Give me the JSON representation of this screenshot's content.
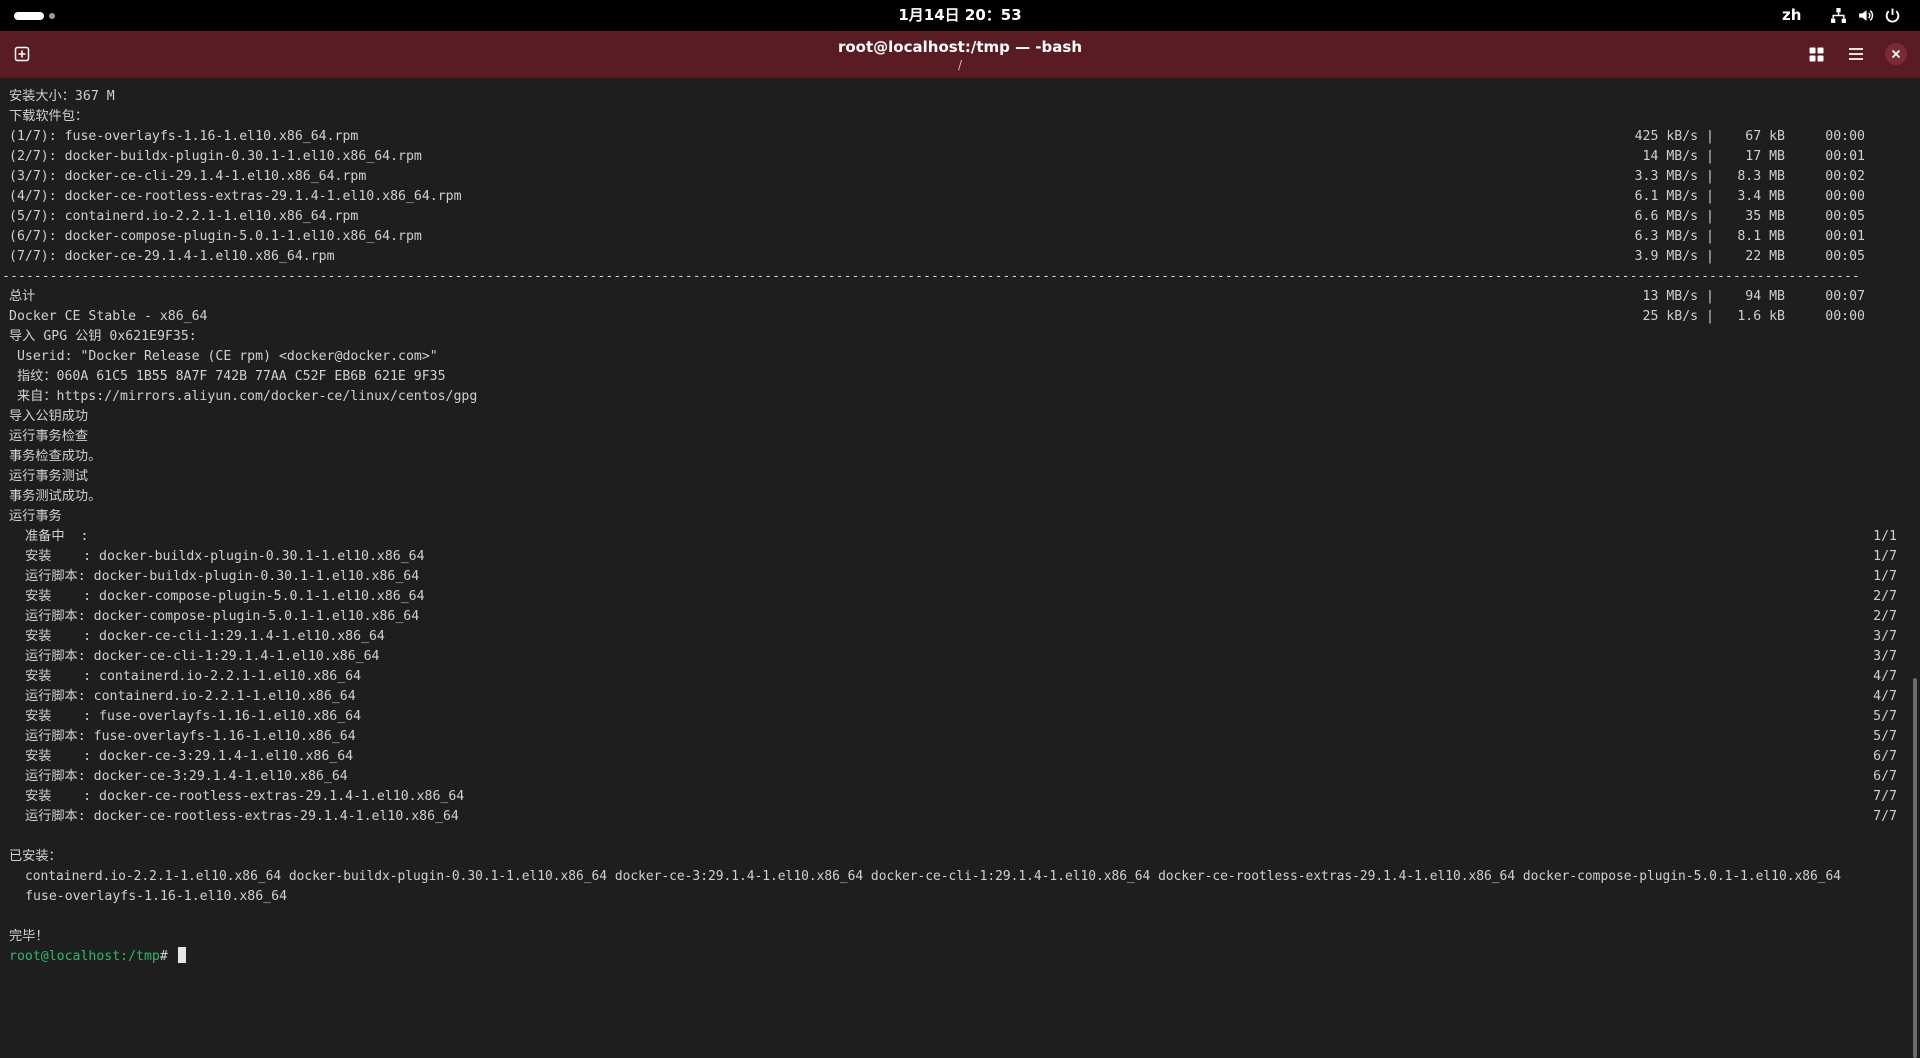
{
  "topbar": {
    "clock": "1月14日  20：53",
    "lang": "zh",
    "tray_icons": [
      "network-icon",
      "volume-icon",
      "power-icon"
    ]
  },
  "window": {
    "title": "root@localhost:/tmp — -bash",
    "subtitle": "/",
    "accent_color": "#5a1c24"
  },
  "terminal": {
    "install_size": "安装大小：367 M",
    "downloading": "下载软件包：",
    "downloads": [
      {
        "name": "(1/7): fuse-overlayfs-1.16-1.el10.x86_64.rpm",
        "rate": "425 kB/s |",
        "size": "67 kB",
        "time": "00:00"
      },
      {
        "name": "(2/7): docker-buildx-plugin-0.30.1-1.el10.x86_64.rpm",
        "rate": "14 MB/s |",
        "size": "17 MB",
        "time": "00:01"
      },
      {
        "name": "(3/7): docker-ce-cli-29.1.4-1.el10.x86_64.rpm",
        "rate": "3.3 MB/s |",
        "size": "8.3 MB",
        "time": "00:02"
      },
      {
        "name": "(4/7): docker-ce-rootless-extras-29.1.4-1.el10.x86_64.rpm",
        "rate": "6.1 MB/s |",
        "size": "3.4 MB",
        "time": "00:00"
      },
      {
        "name": "(5/7): containerd.io-2.2.1-1.el10.x86_64.rpm",
        "rate": "6.6 MB/s |",
        "size": "35 MB",
        "time": "00:05"
      },
      {
        "name": "(6/7): docker-compose-plugin-5.0.1-1.el10.x86_64.rpm",
        "rate": "6.3 MB/s |",
        "size": "8.1 MB",
        "time": "00:01"
      },
      {
        "name": "(7/7): docker-ce-29.1.4-1.el10.x86_64.rpm",
        "rate": "3.9 MB/s |",
        "size": "22 MB",
        "time": "00:05"
      }
    ],
    "separator": "------------------------------------------------------------------------------------------------------------------------------------------------------------------------------------------------------------------------------------------",
    "total": {
      "name": "总计",
      "rate": "13 MB/s |",
      "size": "94 MB",
      "time": "00:07"
    },
    "repo": {
      "name": "Docker CE Stable - x86_64",
      "rate": "25 kB/s |",
      "size": "1.6 kB",
      "time": "00:00"
    },
    "gpg_lines": [
      "导入 GPG 公钥 0x621E9F35:",
      " Userid: \"Docker Release (CE rpm) <docker@docker.com>\"",
      " 指纹：060A 61C5 1B55 8A7F 742B 77AA C52F EB6B 621E 9F35",
      " 来自：https://mirrors.aliyun.com/docker-ce/linux/centos/gpg",
      "导入公钥成功",
      "运行事务检查",
      "事务检查成功。",
      "运行事务测试",
      "事务测试成功。",
      "运行事务"
    ],
    "transaction": [
      {
        "step": "准备中  :",
        "progress": "1/1"
      },
      {
        "step": "安装    : docker-buildx-plugin-0.30.1-1.el10.x86_64",
        "progress": "1/7"
      },
      {
        "step": "运行脚本: docker-buildx-plugin-0.30.1-1.el10.x86_64",
        "progress": "1/7"
      },
      {
        "step": "安装    : docker-compose-plugin-5.0.1-1.el10.x86_64",
        "progress": "2/7"
      },
      {
        "step": "运行脚本: docker-compose-plugin-5.0.1-1.el10.x86_64",
        "progress": "2/7"
      },
      {
        "step": "安装    : docker-ce-cli-1:29.1.4-1.el10.x86_64",
        "progress": "3/7"
      },
      {
        "step": "运行脚本: docker-ce-cli-1:29.1.4-1.el10.x86_64",
        "progress": "3/7"
      },
      {
        "step": "安装    : containerd.io-2.2.1-1.el10.x86_64",
        "progress": "4/7"
      },
      {
        "step": "运行脚本: containerd.io-2.2.1-1.el10.x86_64",
        "progress": "4/7"
      },
      {
        "step": "安装    : fuse-overlayfs-1.16-1.el10.x86_64",
        "progress": "5/7"
      },
      {
        "step": "运行脚本: fuse-overlayfs-1.16-1.el10.x86_64",
        "progress": "5/7"
      },
      {
        "step": "安装    : docker-ce-3:29.1.4-1.el10.x86_64",
        "progress": "6/7"
      },
      {
        "step": "运行脚本: docker-ce-3:29.1.4-1.el10.x86_64",
        "progress": "6/7"
      },
      {
        "step": "安装    : docker-ce-rootless-extras-29.1.4-1.el10.x86_64",
        "progress": "7/7"
      },
      {
        "step": "运行脚本: docker-ce-rootless-extras-29.1.4-1.el10.x86_64",
        "progress": "7/7"
      }
    ],
    "installed_header": "已安装：",
    "installed_line1": "containerd.io-2.2.1-1.el10.x86_64 docker-buildx-plugin-0.30.1-1.el10.x86_64 docker-ce-3:29.1.4-1.el10.x86_64 docker-ce-cli-1:29.1.4-1.el10.x86_64 docker-ce-rootless-extras-29.1.4-1.el10.x86_64 docker-compose-plugin-5.0.1-1.el10.x86_64",
    "installed_line2": "fuse-overlayfs-1.16-1.el10.x86_64",
    "done": "完毕！",
    "prompt_user": "root@localhost",
    "prompt_path": ":/tmp",
    "prompt_symbol": "#"
  }
}
